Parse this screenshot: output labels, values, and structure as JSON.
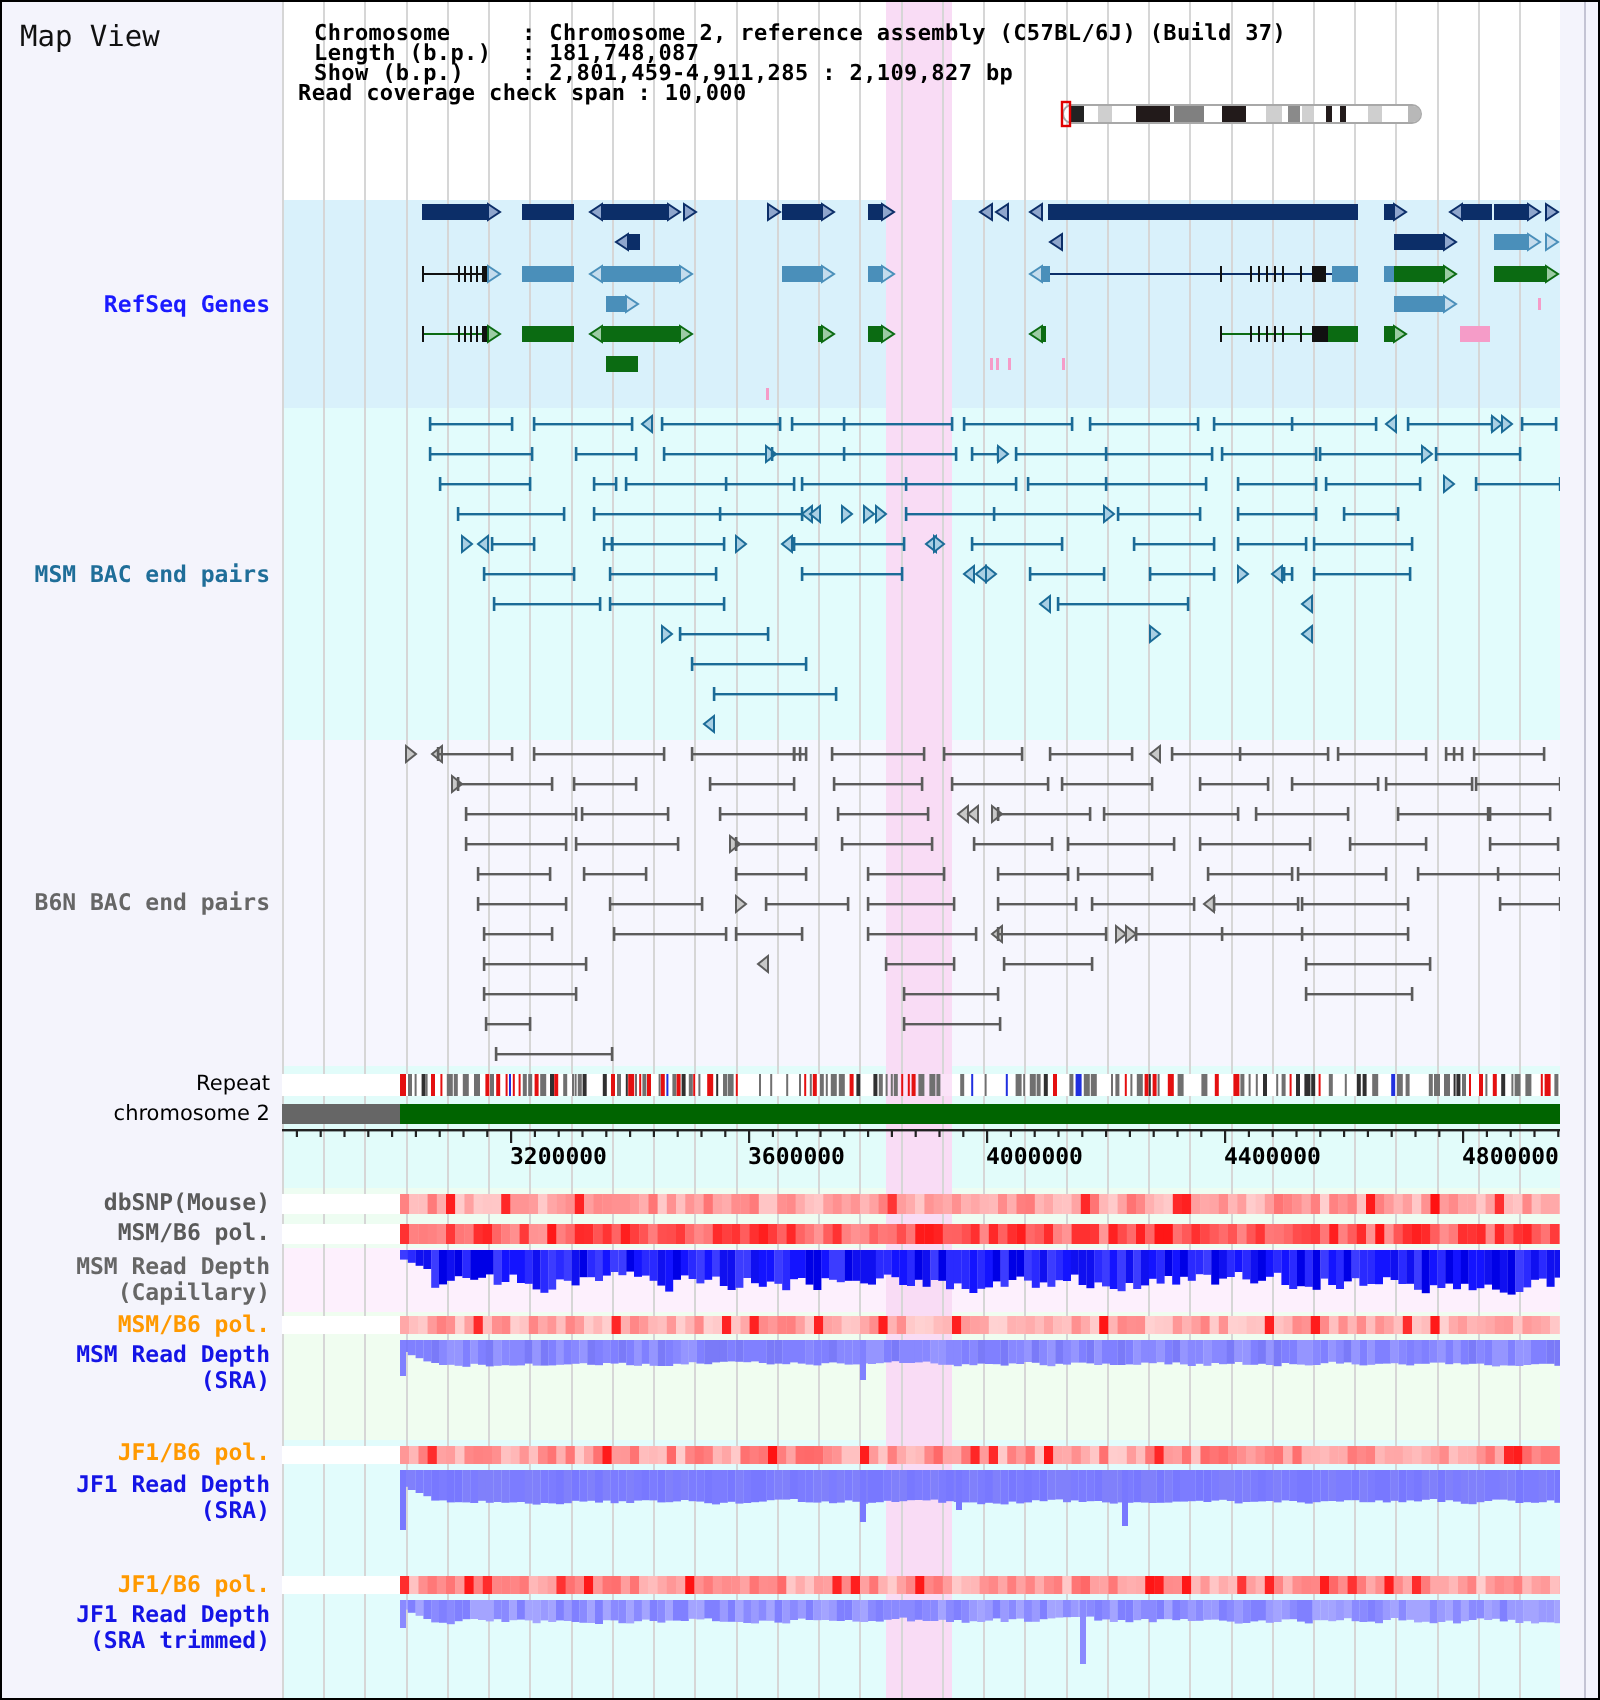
{
  "window": {
    "title": "Map View"
  },
  "header": {
    "info": [
      {
        "label": "Chromosome",
        "value": ": Chromosome 2, reference assembly (C57BL/6J) (Build 37)"
      },
      {
        "label": "Length (b.p.)",
        "value": ": 181,748,087"
      },
      {
        "label": "Show (b.p.)",
        "value": ": 2,801,459-4,911,285 : 2,109,827 bp"
      }
    ],
    "coverage": {
      "label": "Read coverage check span",
      "value": ": 10,000"
    }
  },
  "tracks": [
    {
      "kind": "genes",
      "label": "RefSeq Genes",
      "color": "#1a1aff"
    },
    {
      "kind": "bac",
      "label": "MSM BAC end pairs",
      "color": "#1f6e99"
    },
    {
      "kind": "bac",
      "label": "B6N BAC end pairs",
      "color": "#666666"
    },
    {
      "kind": "repeat",
      "label": "Repeat",
      "color": "#000000"
    },
    {
      "kind": "chromosome",
      "label": "chromosome 2",
      "color": "#000000"
    },
    {
      "kind": "ruler",
      "ticks": [
        "3200000",
        "3600000",
        "4000000",
        "4400000",
        "4800000"
      ]
    },
    {
      "kind": "heatmap",
      "label": "dbSNP(Mouse)",
      "color": "#5a5a5a"
    },
    {
      "kind": "heatmap",
      "label": "MSM/B6 pol.",
      "color": "#5a5a5a"
    },
    {
      "kind": "depth",
      "label": "MSM Read Depth (Capillary)",
      "color": "#666666"
    },
    {
      "kind": "heatmap",
      "label": "MSM/B6 pol.",
      "color": "#ff9900"
    },
    {
      "kind": "depth",
      "label": "MSM Read Depth (SRA)",
      "color": "#1414e6"
    },
    {
      "kind": "heatmap",
      "label": "JF1/B6 pol.",
      "color": "#ff9900"
    },
    {
      "kind": "depth",
      "label": "JF1 Read Depth (SRA)",
      "color": "#1414e6"
    },
    {
      "kind": "heatmap",
      "label": "JF1/B6 pol.",
      "color": "#ff9900"
    },
    {
      "kind": "depth",
      "label": "JF1 Read Depth (SRA trimmed)",
      "color": "#1414e6"
    }
  ]
}
